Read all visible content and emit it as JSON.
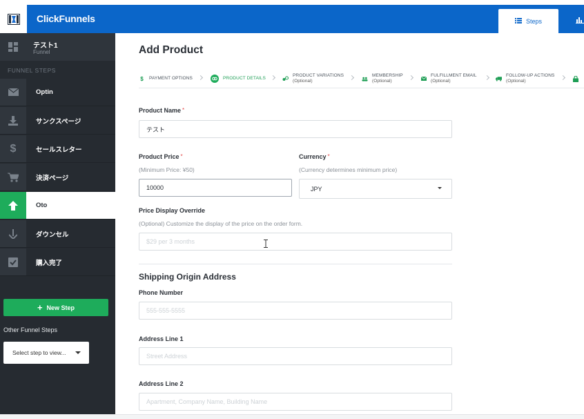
{
  "app": {
    "brand": "ClickFunnels",
    "top_tabs": {
      "steps_label": "Steps"
    }
  },
  "sidebar": {
    "funnel_name": "テスト1",
    "funnel_type": "Funnel",
    "section_heading": "FUNNEL STEPS",
    "steps": [
      {
        "label": "Optin",
        "icon": "envelope-icon"
      },
      {
        "label": "サンクスページ",
        "icon": "download-icon"
      },
      {
        "label": "セールスレター",
        "icon": "dollar-icon"
      },
      {
        "label": "決済ページ",
        "icon": "cart-icon"
      },
      {
        "label": "Oto",
        "icon": "arrow-up-icon",
        "active": true
      },
      {
        "label": "ダウンセル",
        "icon": "arrow-down-icon"
      },
      {
        "label": "購入完了",
        "icon": "checkbox-icon"
      }
    ],
    "new_step_label": "New Step",
    "other_steps_label": "Other Funnel Steps",
    "select_step_placeholder": "Select step to view..."
  },
  "main": {
    "title": "Add Product",
    "wizard": [
      {
        "label": "PAYMENT OPTIONS",
        "sub": "",
        "icon": "dollar-icon"
      },
      {
        "label": "PRODUCT DETAILS",
        "sub": "",
        "icon": "gear-icon",
        "active": true
      },
      {
        "label": "PRODUCT VARIATIONS",
        "sub": "(Optional)",
        "icon": "variations-icon"
      },
      {
        "label": "MEMBERSHIP",
        "sub": "(Optional)",
        "icon": "users-icon"
      },
      {
        "label": "FULFILLMENT EMAIL",
        "sub": "(Optional)",
        "icon": "envelope-icon"
      },
      {
        "label": "FOLLOW-UP ACTIONS",
        "sub": "(Optional)",
        "icon": "truck-icon"
      }
    ],
    "form": {
      "product_name_label": "Product Name",
      "product_name_value": "テスト",
      "product_price_label": "Product Price",
      "product_price_hint": "(Minimum Price: ¥50)",
      "product_price_value": "10000",
      "currency_label": "Currency",
      "currency_hint": "(Currency determines minimum price)",
      "currency_value": "JPY",
      "price_override_label": "Price Display Override",
      "price_override_hint": "(Optional) Customize the display of the price on the order form.",
      "price_override_placeholder": "$29 per 3 months",
      "shipping_title": "Shipping Origin Address",
      "phone_label": "Phone Number",
      "phone_placeholder": "555-555-5555",
      "address1_label": "Address Line 1",
      "address1_placeholder": "Street Address",
      "address2_label": "Address Line 2",
      "address2_placeholder": "Apartment, Company Name, Building Name"
    }
  },
  "colors": {
    "brand_blue": "#0b66c9",
    "sidebar_bg": "#262b31",
    "accent_green": "#1eac5b",
    "required_red": "#e34848"
  }
}
